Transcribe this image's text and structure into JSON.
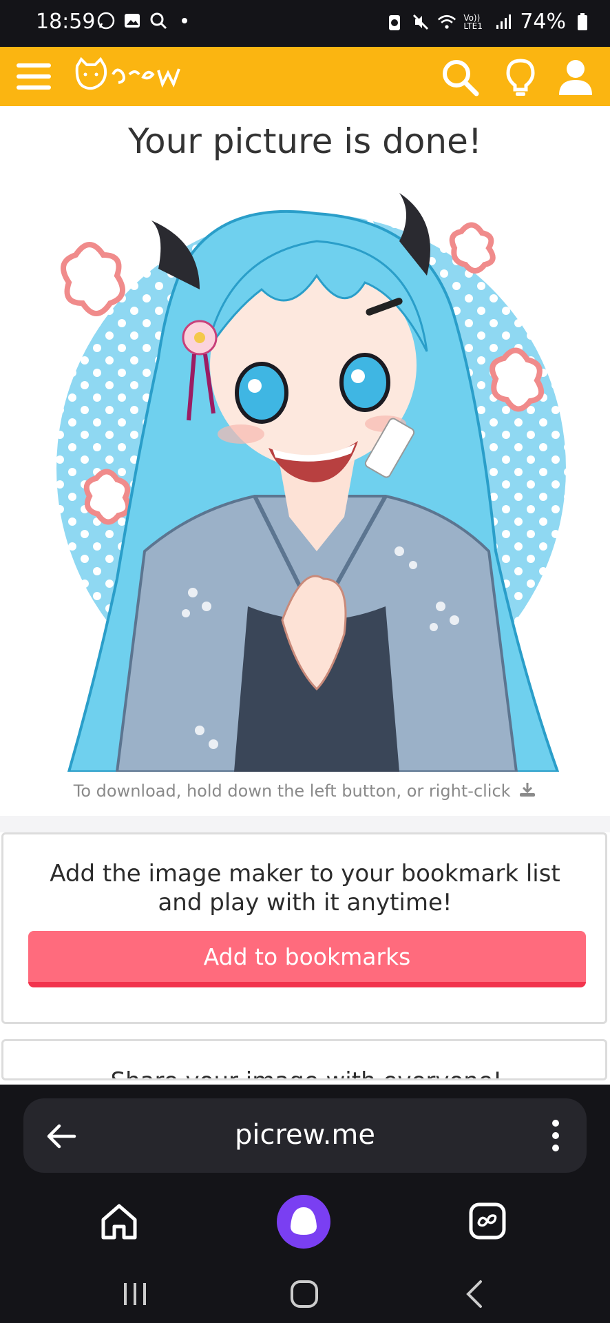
{
  "status_bar": {
    "time": "18:59",
    "battery": "74%",
    "icons": [
      "whatsapp-icon",
      "gallery-icon",
      "search-icon",
      "dot-icon",
      "battery-saver-icon",
      "mute-icon",
      "wifi-icon",
      "volte-icon",
      "signal-icon",
      "battery-icon"
    ],
    "volte_label": "Vo)) LTE1"
  },
  "header": {
    "logo_text": "Picrew",
    "icons": [
      "menu-icon",
      "search-icon",
      "lightbulb-icon",
      "user-icon"
    ],
    "brand_color": "#fbb511"
  },
  "main": {
    "title": "Your picture is done!",
    "download_hint": "To download, hold down the left button, or right-click",
    "download_icon": "download-icon"
  },
  "bookmark_card": {
    "message": "Add the image maker to your bookmark list and play with it anytime!",
    "button_label": "Add to bookmarks",
    "button_color": "#ff6b7d"
  },
  "share_card": {
    "message": "Share your image with everyone!"
  },
  "browser": {
    "url": "picrew.me",
    "icons": [
      "back-arrow-icon",
      "more-vert-icon",
      "home-icon",
      "assistant-icon",
      "tabs-icon"
    ]
  },
  "system_nav": {
    "icons": [
      "recent-apps-icon",
      "home-circle-icon",
      "back-chevron-icon"
    ]
  }
}
